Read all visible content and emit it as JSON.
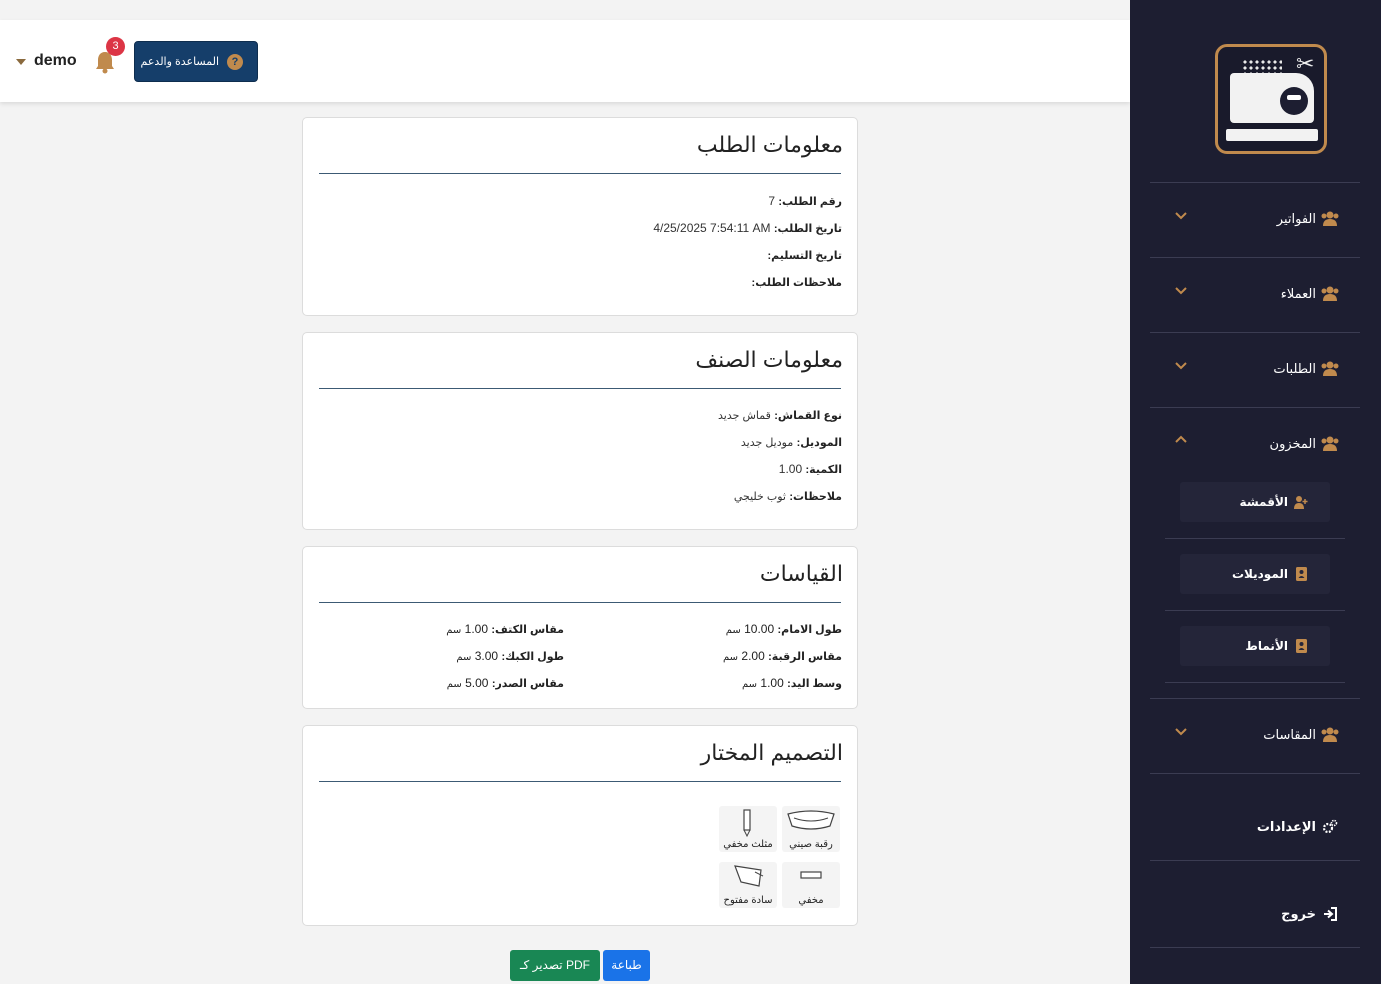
{
  "header": {
    "user_name": "demo",
    "notification_count": "3",
    "help_label": "المساعدة والدعم"
  },
  "sidebar": {
    "items": [
      {
        "label": "الفواتير"
      },
      {
        "label": "العملاء"
      },
      {
        "label": "الطلبات"
      },
      {
        "label": "المخزون"
      },
      {
        "label": "المقاسات"
      }
    ],
    "inventory_sub": [
      {
        "label": "الأقمشة"
      },
      {
        "label": "الموديلات"
      },
      {
        "label": "الأنماط"
      }
    ],
    "settings_label": "الإعدادات",
    "logout_label": "خروج"
  },
  "order_info": {
    "title": "معلومات الطلب",
    "order_number_label": "رقم الطلب:",
    "order_number": "7",
    "order_date_label": "تاريخ الطلب:",
    "order_date": "4/25/2025 7:54:11 AM",
    "delivery_date_label": "تاريخ التسليم:",
    "delivery_date": "",
    "notes_label": "ملاحظات الطلب:",
    "notes": ""
  },
  "item_info": {
    "title": "معلومات الصنف",
    "fabric_label": "نوع القماش:",
    "fabric": "قماش جديد",
    "model_label": "الموديل:",
    "model": "موديل جديد",
    "quantity_label": "الكمية:",
    "quantity": "1.00",
    "notes_label": "ملاحظات:",
    "notes": "ثوب خليجي"
  },
  "measurements": {
    "title": "القياسات",
    "unit": "سم",
    "right_column": [
      {
        "label": "طول الامام:",
        "value": "10.00"
      },
      {
        "label": "مقاس الرقبة:",
        "value": "2.00"
      },
      {
        "label": "وسط اليد:",
        "value": "1.00"
      }
    ],
    "left_column": [
      {
        "label": "مقاس الكتف:",
        "value": "1.00"
      },
      {
        "label": "طول الكبك:",
        "value": "3.00"
      },
      {
        "label": "مقاس الصدر:",
        "value": "5.00"
      }
    ]
  },
  "design": {
    "title": "التصميم المختار",
    "options": [
      {
        "caption": "رقبة صيني",
        "icon": "collar-icon"
      },
      {
        "caption": "مثلث مخفي",
        "icon": "pen-pocket-icon"
      },
      {
        "caption": "مخفي",
        "icon": "hidden-placket-icon"
      },
      {
        "caption": "سادة مفتوح",
        "icon": "open-pocket-icon"
      }
    ]
  },
  "actions": {
    "print_label": "طباعة",
    "pdf_label": "تصدير كـ PDF"
  },
  "colors": {
    "sidebar_bg": "#1d1e31",
    "accent": "#c08a4d",
    "help_button": "#153e6a",
    "print_button": "#1a73e8",
    "pdf_button": "#198754",
    "badge": "#dc3545"
  }
}
